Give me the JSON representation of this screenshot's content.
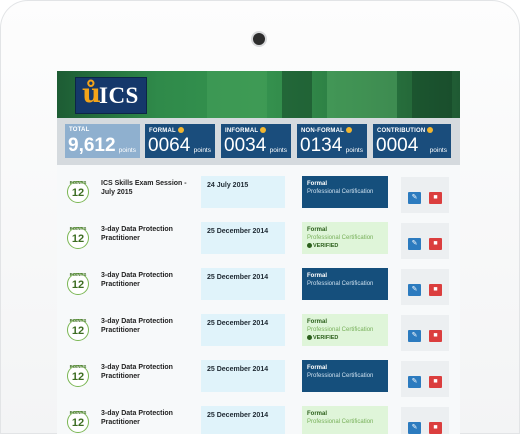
{
  "header": {
    "logo_text": "ICS"
  },
  "stats": [
    {
      "label": "TOTAL",
      "value": "9,612",
      "unit": "points",
      "help": false
    },
    {
      "label": "FORMAL",
      "value": "0064",
      "unit": "points",
      "help": true
    },
    {
      "label": "INFORMAL",
      "value": "0034",
      "unit": "points",
      "help": true
    },
    {
      "label": "NON-FORMAL",
      "value": "0134",
      "unit": "points",
      "help": true
    },
    {
      "label": "CONTRIBUTION",
      "value": "0004",
      "unit": "points",
      "help": true
    }
  ],
  "activities": [
    {
      "points_label": "POINTS",
      "points": "12",
      "title": "ICS Skills Exam Session - July 2015",
      "date": "24 July 2015",
      "type": "Formal",
      "sub": "Professional Certification",
      "verified": ""
    },
    {
      "points_label": "POINTS",
      "points": "12",
      "title": "3-day Data Protection Practitioner",
      "date": "25 December 2014",
      "type": "Formal",
      "sub": "Professional Certification",
      "verified": "VERIFIED"
    },
    {
      "points_label": "POINTS",
      "points": "12",
      "title": "3-day Data Protection Practitioner",
      "date": "25 December 2014",
      "type": "Formal",
      "sub": "Professional Certification",
      "verified": ""
    },
    {
      "points_label": "POINTS",
      "points": "12",
      "title": "3-day Data Protection Practitioner",
      "date": "25 December 2014",
      "type": "Formal",
      "sub": "Professional Certification",
      "verified": "VERIFIED"
    },
    {
      "points_label": "POINTS",
      "points": "12",
      "title": "3-day Data Protection Practitioner",
      "date": "25 December 2014",
      "type": "Formal",
      "sub": "Professional Certification",
      "verified": ""
    },
    {
      "points_label": "POINTS",
      "points": "12",
      "title": "3-day Data Protection Practitioner",
      "date": "25 December 2014",
      "type": "Formal",
      "sub": "Professional Certification",
      "verified": ""
    }
  ],
  "icons": {
    "edit": "pencil-icon",
    "delete": "trash-icon"
  },
  "colors": {
    "brand_blue": "#154f7c",
    "verified_green": "#dff5d9",
    "banner_green": "#2f8a4a",
    "delete_red": "#db3e3e",
    "edit_blue": "#2c7bbf"
  }
}
